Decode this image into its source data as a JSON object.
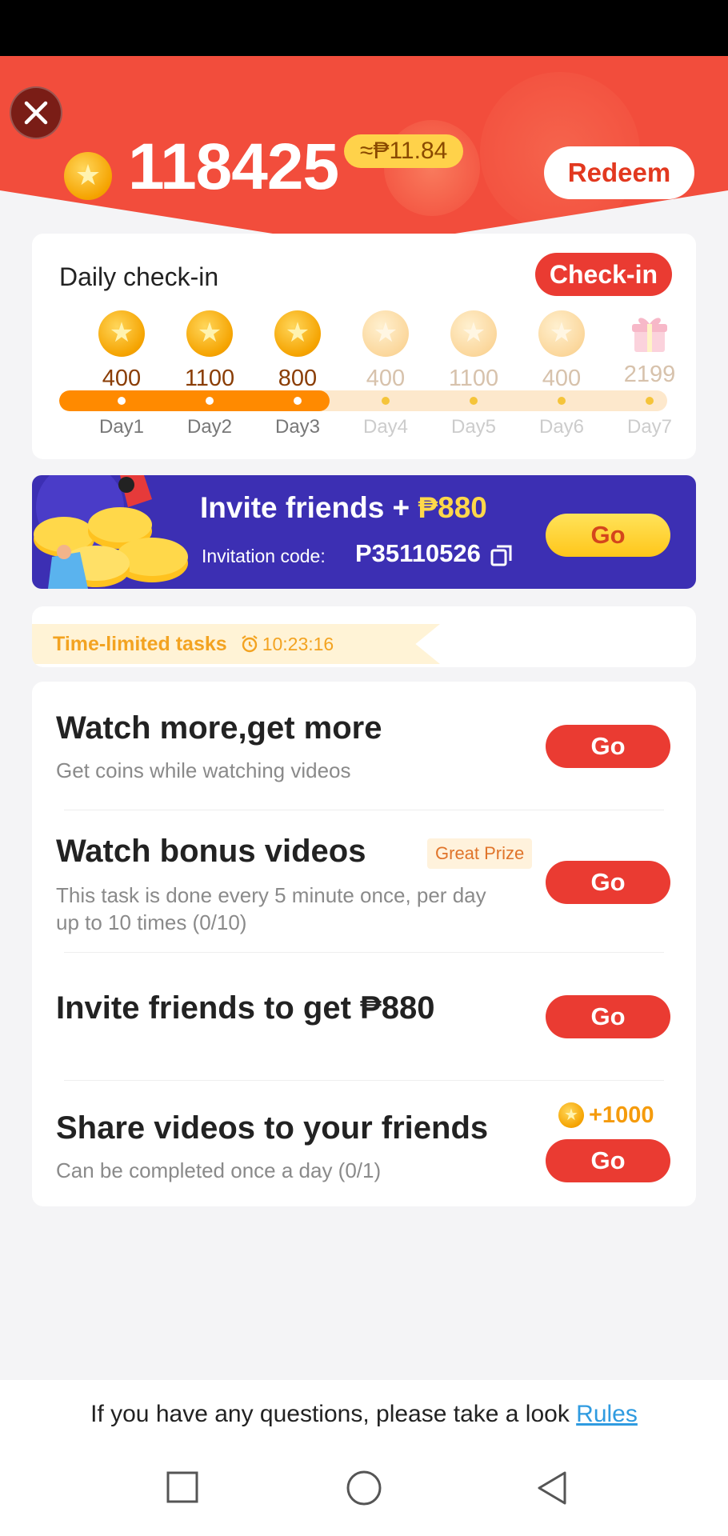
{
  "header": {
    "balance": "118425",
    "peso_value": "≈₱11.84",
    "redeem_label": "Redeem"
  },
  "checkin": {
    "title": "Daily check-in",
    "button_label": "Check-in",
    "progress_days_completed": 3,
    "days": [
      {
        "label": "Day1",
        "amount": "400",
        "done": true,
        "icon": "coin-icon"
      },
      {
        "label": "Day2",
        "amount": "1100",
        "done": true,
        "icon": "coin-icon"
      },
      {
        "label": "Day3",
        "amount": "800",
        "done": true,
        "icon": "coin-icon"
      },
      {
        "label": "Day4",
        "amount": "400",
        "done": false,
        "icon": "coin-icon"
      },
      {
        "label": "Day5",
        "amount": "1100",
        "done": false,
        "icon": "coin-icon"
      },
      {
        "label": "Day6",
        "amount": "400",
        "done": false,
        "icon": "coin-icon"
      },
      {
        "label": "Day7",
        "amount": "2199",
        "done": false,
        "icon": "gift-icon"
      }
    ]
  },
  "invite_banner": {
    "title_prefix": "Invite friends + ",
    "title_amount": "₱880",
    "code_label": "Invitation code:",
    "code": "P35110526",
    "go_label": "Go"
  },
  "time_limited": {
    "title": "Time-limited tasks",
    "timer": "10:23:16"
  },
  "tasks": [
    {
      "title": "Watch more,get more",
      "desc": "Get coins while watching videos",
      "go_label": "Go"
    },
    {
      "title": "Watch bonus videos",
      "badge": "Great Prize",
      "desc_line1": "This task is done every 5 minute once, per day",
      "desc_line2": "up to 10 times (0/10)",
      "go_label": "Go"
    },
    {
      "title": "Invite friends to get ₱880",
      "go_label": "Go"
    },
    {
      "title": "Share videos to your friends",
      "reward": "+1000",
      "desc": "Can be completed once a day (0/1)",
      "go_label": "Go"
    }
  ],
  "footer": {
    "text": "If you have any questions, please take a look ",
    "rules_link": "Rules"
  },
  "colors": {
    "header_red": "#f24d3c",
    "accent_orange": "#ff8a00",
    "button_red": "#ea3b32",
    "banner_purple": "#3c2fb3",
    "coin_gold": "#f5a300"
  }
}
